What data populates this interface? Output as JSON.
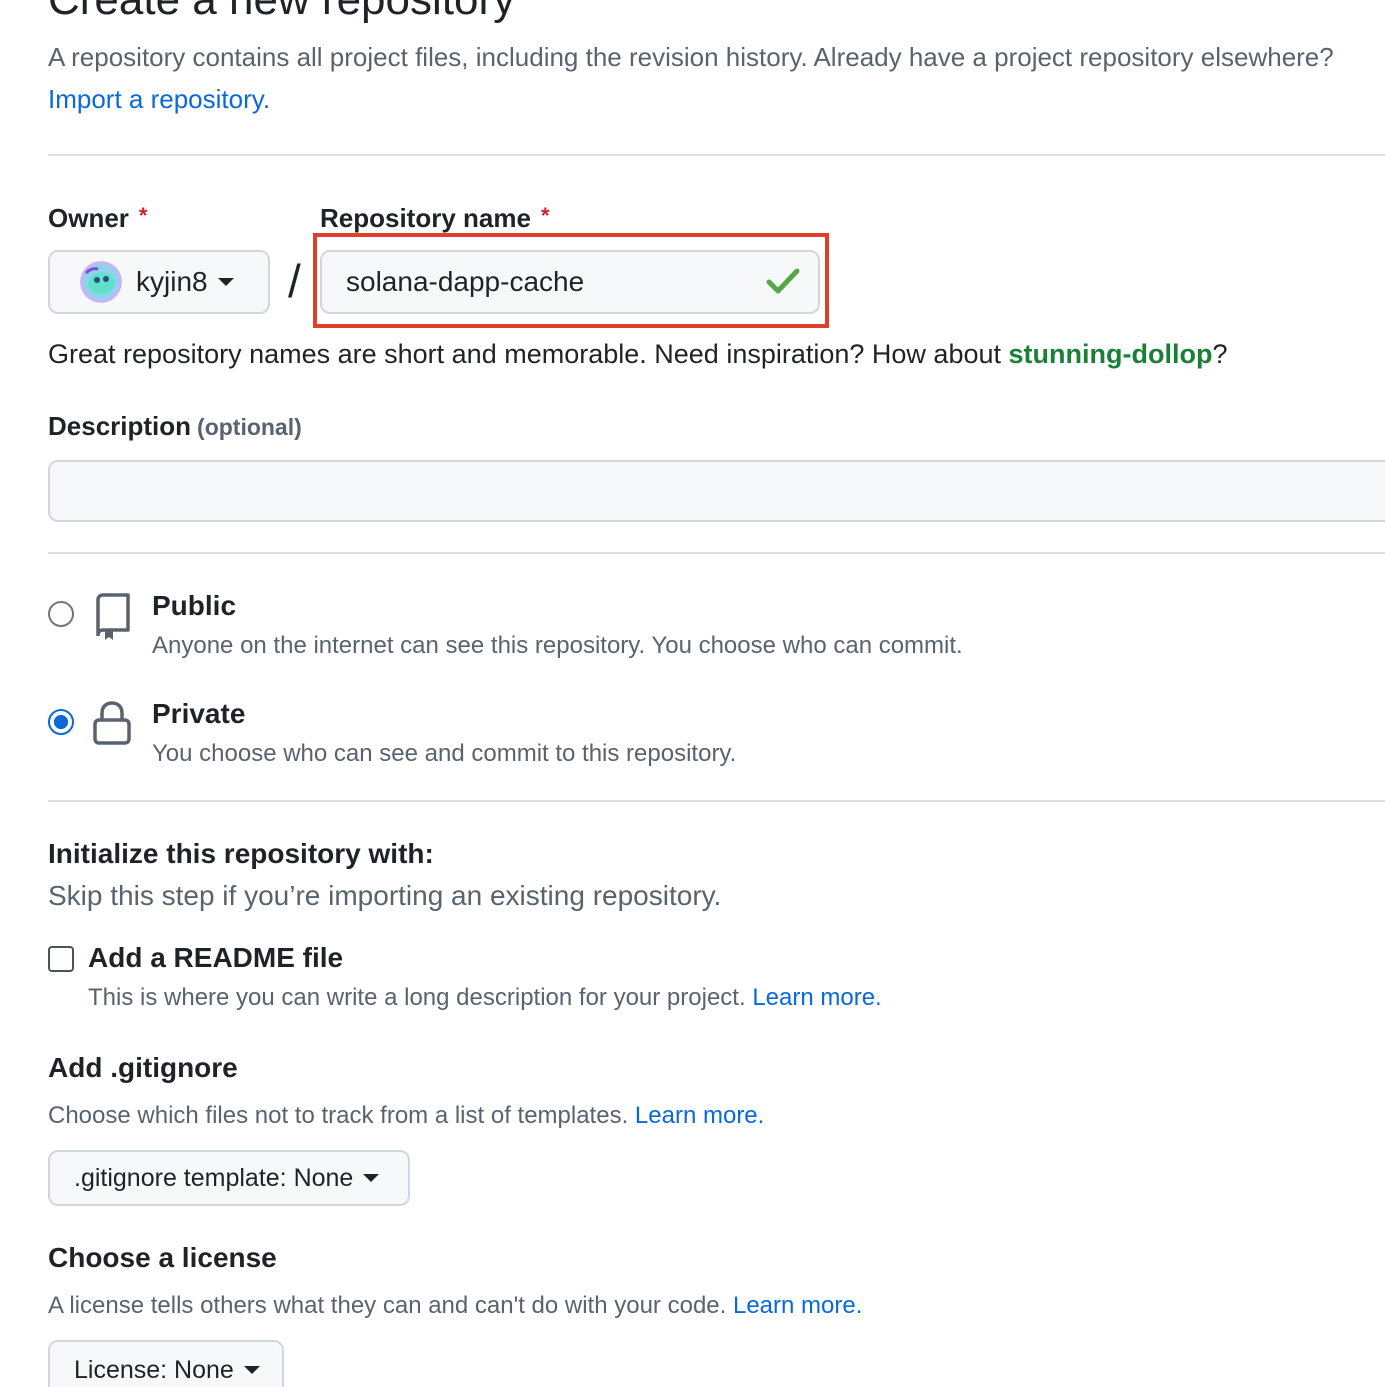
{
  "header": {
    "title": "Create a new repository",
    "intro_text": "A repository contains all project files, including the revision history. Already have a project repository elsewhere?",
    "import_link": "Import a repository."
  },
  "owner": {
    "label": "Owner",
    "required_mark": "*",
    "selected": "kyjin8",
    "avatar_icon": "user-avatar"
  },
  "separator": "/",
  "repo_name": {
    "label": "Repository name",
    "required_mark": "*",
    "value": "solana-dapp-cache",
    "valid_icon": "check-icon",
    "valid_color": "#1a7f37",
    "highlight_color": "#e0402a"
  },
  "name_hint": {
    "text_before": "Great repository names are short and memorable. Need inspiration? How about",
    "suggestion": "stunning-dollop",
    "text_after": "?"
  },
  "description": {
    "label": "Description",
    "optional_text": "(optional)",
    "value": ""
  },
  "visibility": {
    "options": [
      {
        "title": "Public",
        "desc": "Anyone on the internet can see this repository. You choose who can commit.",
        "icon": "repo-icon",
        "checked": false
      },
      {
        "title": "Private",
        "desc": "You choose who can see and commit to this repository.",
        "icon": "lock-icon",
        "checked": true
      }
    ]
  },
  "init": {
    "heading": "Initialize this repository with:",
    "sub": "Skip this step if you’re importing an existing repository.",
    "readme": {
      "label": "Add a README file",
      "desc": "This is where you can write a long description for your project.",
      "learn_more": "Learn more.",
      "checked": false
    }
  },
  "gitignore": {
    "heading": "Add .gitignore",
    "desc": "Choose which files not to track from a list of templates.",
    "learn_more": "Learn more.",
    "button_label": ".gitignore template: None"
  },
  "license": {
    "heading": "Choose a license",
    "desc": "A license tells others what they can and can't do with your code.",
    "learn_more": "Learn more.",
    "button_label": "License: None"
  }
}
